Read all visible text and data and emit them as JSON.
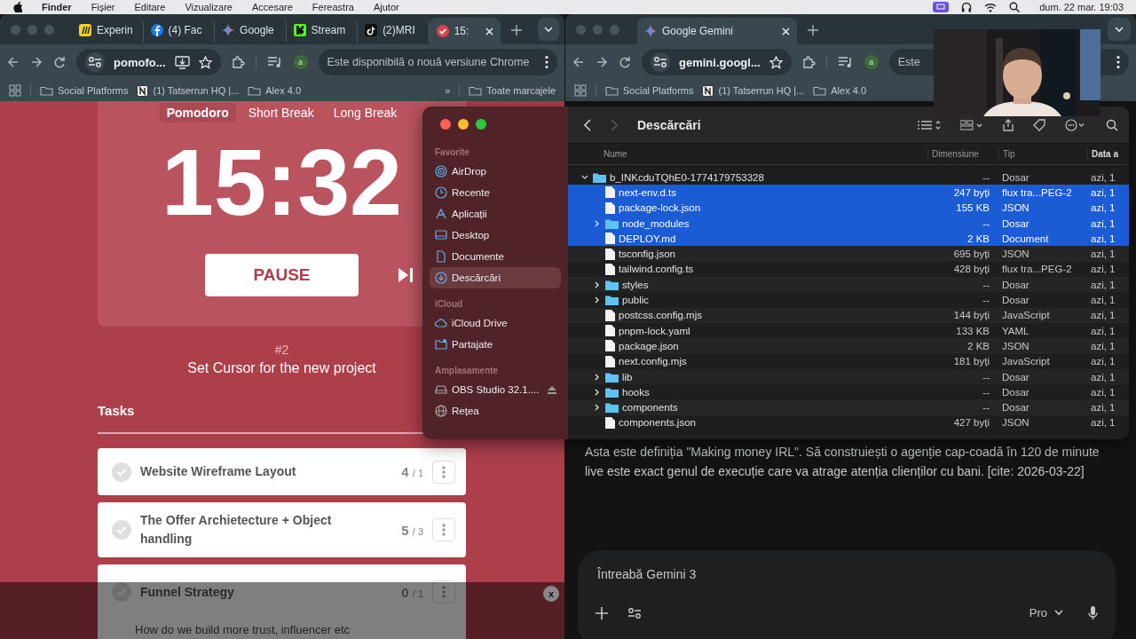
{
  "menu_bar": {
    "items": [
      {
        "label": "Finder"
      },
      {
        "label": "Fișier"
      },
      {
        "label": "Editare"
      },
      {
        "label": "Vizualizare"
      },
      {
        "label": "Accesare"
      },
      {
        "label": "Fereastra"
      },
      {
        "label": "Ajutor"
      }
    ],
    "clock": "dum. 22 mar. 19:03"
  },
  "left_browser": {
    "tabs": [
      {
        "label": "Experin",
        "kind": "miro",
        "selected": false
      },
      {
        "label": "(4) Fac",
        "kind": "facebook",
        "selected": false
      },
      {
        "label": "Google",
        "kind": "gemini",
        "selected": false
      },
      {
        "label": "Stream",
        "kind": "kick",
        "selected": false
      },
      {
        "label": "(2)MRI",
        "kind": "tiktok",
        "selected": false
      },
      {
        "label": "15:",
        "kind": "pomodoro",
        "selected": true
      }
    ],
    "address": "pomofo...",
    "profile": "a",
    "update_notice": "Este disponibilă o nouă versiune Chrome",
    "bookmarks": [
      {
        "label": "Social Platforms",
        "kind": "folder"
      },
      {
        "label": "(1) Tatserrun HQ |...",
        "kind": "notion"
      },
      {
        "label": "Alex 4.0",
        "kind": "folder"
      }
    ],
    "overflow": "»",
    "all_bookmarks": "Toate marcajele"
  },
  "pomodoro": {
    "modes": [
      {
        "label": "Pomodoro",
        "selected": true
      },
      {
        "label": "Short Break",
        "selected": false
      },
      {
        "label": "Long Break",
        "selected": false
      }
    ],
    "timer": "15:32",
    "action": "PAUSE",
    "session": "#2",
    "current_task": "Set Cursor for the new project",
    "tasks_title": "Tasks",
    "tasks": [
      {
        "title": "Website Wireframe Layout",
        "done_count": "4",
        "estimate": "/ 1"
      },
      {
        "title": "The Offer Archietecture + Object handling",
        "done_count": "5",
        "estimate": "/ 3"
      },
      {
        "title": "Funnel Strategy",
        "done_count": "0",
        "estimate": "/ 1",
        "note": "How do we build more trust, influencer etc"
      }
    ],
    "overlay_close": "x"
  },
  "right_browser": {
    "tabs": [
      {
        "label": "Google Gemini",
        "kind": "gemini",
        "selected": true
      }
    ],
    "address": "gemini.googl...",
    "profile": "a",
    "update_notice": "Este",
    "bookmarks": [
      {
        "label": "Social Platforms",
        "kind": "folder"
      },
      {
        "label": "(1) Tatserrun HQ |...",
        "kind": "notion"
      },
      {
        "label": "Alex 4.0",
        "kind": "folder"
      }
    ]
  },
  "gemini": {
    "response": "Asta este definiția \"Making money IRL\". Să construiești o agenție cap-coadă în 120 de minute live este exact genul de execuție care va atrage atenția clienților cu bani. [cite: 2026-03-22]",
    "input_placeholder": "Întreabă Gemini 3",
    "model": "Pro"
  },
  "finder": {
    "title": "Descărcări",
    "sidebar": [
      {
        "heading": "Favorite",
        "items": [
          {
            "label": "AirDrop",
            "kind": "airdrop",
            "selected": false
          },
          {
            "label": "Recente",
            "kind": "clock",
            "selected": false
          },
          {
            "label": "Aplicații",
            "kind": "apps",
            "selected": false
          },
          {
            "label": "Desktop",
            "kind": "desktop",
            "selected": false
          },
          {
            "label": "Documente",
            "kind": "doc",
            "selected": false
          },
          {
            "label": "Descărcări",
            "kind": "download",
            "selected": true
          }
        ]
      },
      {
        "heading": "iCloud",
        "items": [
          {
            "label": "iCloud Drive",
            "kind": "cloud",
            "selected": false
          },
          {
            "label": "Partajate",
            "kind": "shared",
            "selected": false
          }
        ]
      },
      {
        "heading": "Amplasamente",
        "items": [
          {
            "label": "OBS Studio 32.1....",
            "kind": "disk",
            "selected": false
          },
          {
            "label": "Rețea",
            "kind": "network",
            "selected": false
          }
        ]
      }
    ],
    "columns": [
      "Nume",
      "Dimensiune",
      "Tip",
      "Data a"
    ],
    "rows": [
      {
        "name": "b_INKcduTQhE0-1774179753328",
        "kind": "folder",
        "expanded": true,
        "size": "--",
        "type": "Dosar",
        "date": "azi, 1",
        "selected": false,
        "children": [
          {
            "name": "next-env.d.ts",
            "kind": "file",
            "size": "247 byți",
            "type": "flux tra...PEG-2",
            "date": "azi, 1",
            "selected": true
          },
          {
            "name": "package-lock.json",
            "kind": "file",
            "size": "155 KB",
            "type": "JSON",
            "date": "azi, 1",
            "selected": true
          },
          {
            "name": "node_modules",
            "kind": "folder",
            "expanded": false,
            "size": "--",
            "type": "Dosar",
            "date": "azi, 1",
            "selected": true
          },
          {
            "name": "DEPLOY.md",
            "kind": "file",
            "size": "2 KB",
            "type": "Document",
            "date": "azi, 1",
            "selected": true
          },
          {
            "name": "tsconfig.json",
            "kind": "file",
            "size": "695 byți",
            "type": "JSON",
            "date": "azi, 1",
            "selected": false
          },
          {
            "name": "tailwind.config.ts",
            "kind": "file",
            "size": "428 byți",
            "type": "flux tra...PEG-2",
            "date": "azi, 1",
            "selected": false
          },
          {
            "name": "styles",
            "kind": "folder",
            "expanded": false,
            "size": "--",
            "type": "Dosar",
            "date": "azi, 1",
            "selected": false
          },
          {
            "name": "public",
            "kind": "folder",
            "expanded": false,
            "size": "--",
            "type": "Dosar",
            "date": "azi, 1",
            "selected": false
          },
          {
            "name": "postcss.config.mjs",
            "kind": "file",
            "size": "144 byți",
            "type": "JavaScript",
            "date": "azi, 1",
            "selected": false
          },
          {
            "name": "pnpm-lock.yaml",
            "kind": "file",
            "size": "133 KB",
            "type": "YAML",
            "date": "azi, 1",
            "selected": false
          },
          {
            "name": "package.json",
            "kind": "file",
            "size": "2 KB",
            "type": "JSON",
            "date": "azi, 1",
            "selected": false
          },
          {
            "name": "next.config.mjs",
            "kind": "file",
            "size": "181 byți",
            "type": "JavaScript",
            "date": "azi, 1",
            "selected": false
          },
          {
            "name": "lib",
            "kind": "folder",
            "expanded": false,
            "size": "--",
            "type": "Dosar",
            "date": "azi, 1",
            "selected": false
          },
          {
            "name": "hooks",
            "kind": "folder",
            "expanded": false,
            "size": "--",
            "type": "Dosar",
            "date": "azi, 1",
            "selected": false
          },
          {
            "name": "components",
            "kind": "folder",
            "expanded": false,
            "size": "--",
            "type": "Dosar",
            "date": "azi, 1",
            "selected": false
          },
          {
            "name": "components.json",
            "kind": "file",
            "size": "427 byți",
            "type": "JSON",
            "date": "azi, 1",
            "selected": false
          }
        ]
      }
    ]
  }
}
